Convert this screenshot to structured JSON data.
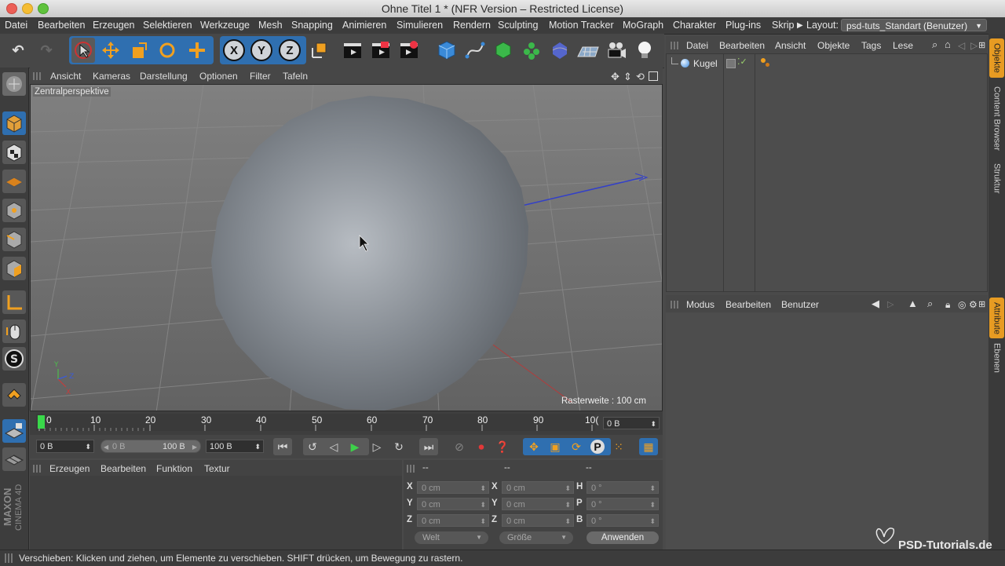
{
  "window": {
    "title": "Ohne Titel 1 * (NFR Version – Restricted License)"
  },
  "menubar": {
    "items": [
      "Datei",
      "Bearbeiten",
      "Erzeugen",
      "Selektieren",
      "Werkzeuge",
      "Mesh",
      "Snapping",
      "Animieren",
      "Simulieren",
      "Rendern",
      "Sculpting",
      "Motion Tracker",
      "MoGraph",
      "Charakter",
      "Plug-ins",
      "Skrip"
    ],
    "layout_label": "Layout:",
    "layout_value": "psd-tuts_Standart (Benutzer)"
  },
  "toolbar": {
    "axis_x": "X",
    "axis_y": "Y",
    "axis_z": "Z"
  },
  "viewport": {
    "menu": [
      "Ansicht",
      "Kameras",
      "Darstellung",
      "Optionen",
      "Filter",
      "Tafeln"
    ],
    "label": "Zentralperspektive",
    "grid_info": "Rasterweite : 100 cm",
    "axis_y": "Y",
    "axis_z": "Z",
    "axis_x": "X"
  },
  "timeline": {
    "ticks": [
      "0",
      "10",
      "20",
      "30",
      "40",
      "50",
      "60",
      "70",
      "80",
      "90",
      "10("
    ],
    "current_frame": "0 B"
  },
  "transport": {
    "start_field": "0 B",
    "range_start": "0 B",
    "range_end": "100 B",
    "end_field": "100 B"
  },
  "materials": {
    "menu": [
      "Erzeugen",
      "Bearbeiten",
      "Funktion",
      "Textur"
    ]
  },
  "coordinates": {
    "headers": [
      "--",
      "--",
      "--"
    ],
    "rows": [
      {
        "label1": "X",
        "val1": "0 cm",
        "label2": "X",
        "val2": "0 cm",
        "label3": "H",
        "val3": "0 °"
      },
      {
        "label1": "Y",
        "val1": "0 cm",
        "label2": "Y",
        "val2": "0 cm",
        "label3": "P",
        "val3": "0 °"
      },
      {
        "label1": "Z",
        "val1": "0 cm",
        "label2": "Z",
        "val2": "0 cm",
        "label3": "B",
        "val3": "0 °"
      }
    ],
    "space_dropdown": "Welt",
    "size_dropdown": "Größe",
    "apply_button": "Anwenden"
  },
  "objects_panel": {
    "menu": [
      "Datei",
      "Bearbeiten",
      "Ansicht",
      "Objekte",
      "Tags",
      "Lese"
    ],
    "object_name": "Kugel"
  },
  "attributes_panel": {
    "menu": [
      "Modus",
      "Bearbeiten",
      "Benutzer"
    ]
  },
  "side_tabs": [
    "Objekte",
    "Content Browser",
    "Struktur",
    "Attribute",
    "Ebenen"
  ],
  "status": {
    "text": "Verschieben: Klicken und ziehen, um Elemente zu verschieben. SHIFT drücken, um Bewegung zu rastern."
  },
  "watermark": "PSD-Tutorials.de",
  "branding": {
    "line1": "MAXON",
    "line2": "CINEMA 4D"
  }
}
